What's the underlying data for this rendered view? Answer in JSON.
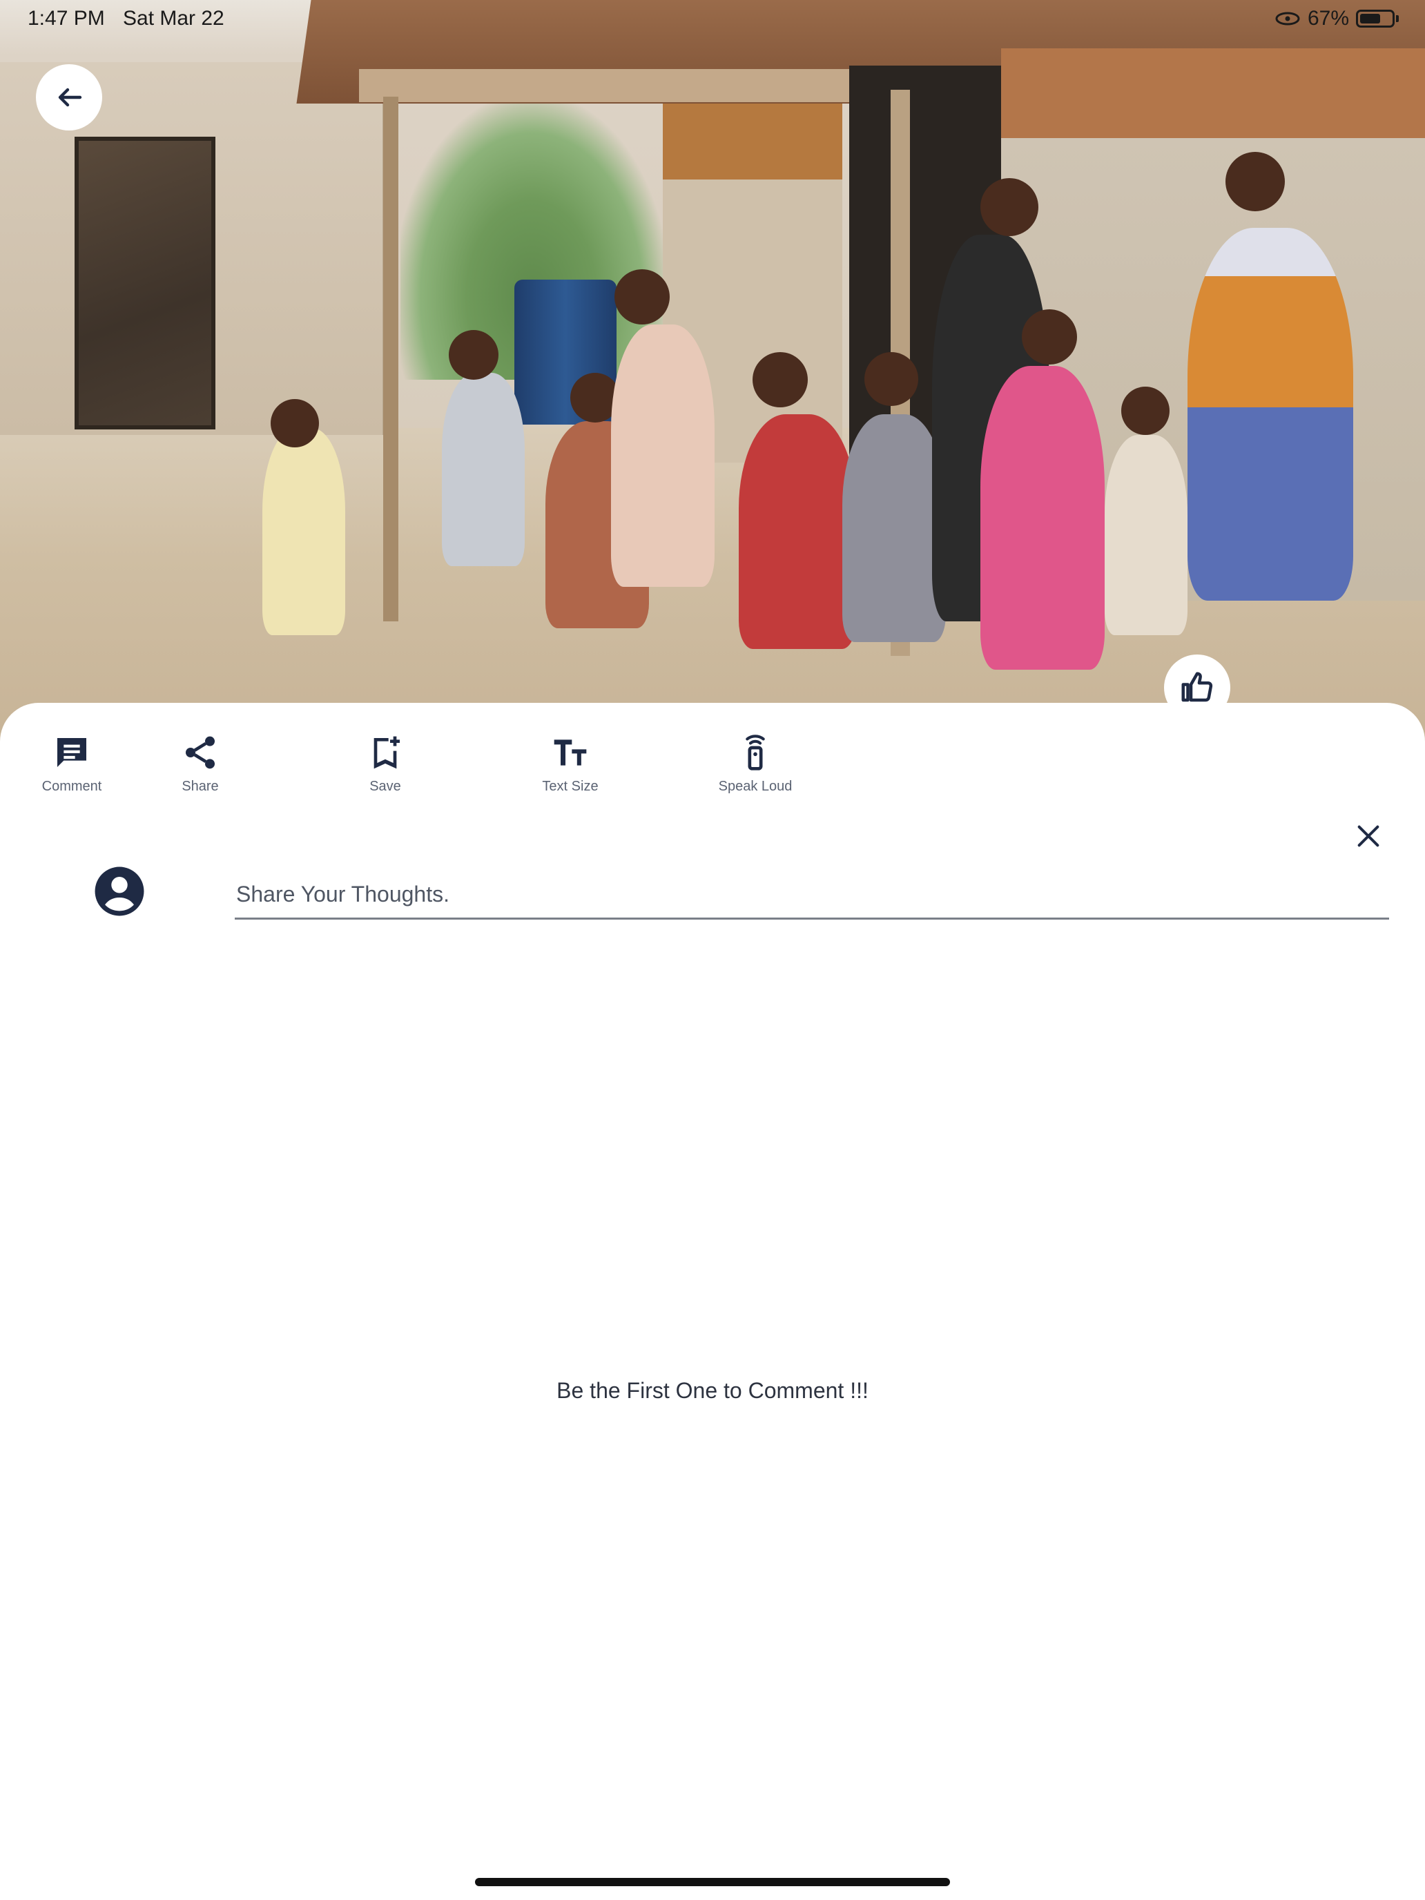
{
  "status_bar": {
    "time": "1:47 PM",
    "date": "Sat Mar 22",
    "battery": "67%",
    "battery_level": 0.67
  },
  "hero": {
    "image_alt": "",
    "back_icon": "arrow-left-icon",
    "like_icon": "thumbs-up-icon"
  },
  "toolbar": {
    "items": [
      {
        "label": "Comment",
        "icon": "comment-icon"
      },
      {
        "label": "Share",
        "icon": "share-icon"
      },
      {
        "label": "Save",
        "icon": "bookmark-add-icon"
      },
      {
        "label": "Text Size",
        "icon": "text-size-icon"
      },
      {
        "label": "Speak Loud",
        "icon": "speaker-icon"
      }
    ]
  },
  "comments": {
    "placeholder": "Share Your Thoughts.",
    "value": "",
    "empty_message": "Be the First One to Comment !!!",
    "close_icon": "close-icon",
    "avatar_icon": "account-circle-icon"
  },
  "colors": {
    "icon": "#1f2a44",
    "label": "#5b6373",
    "underline": "#7a7f88"
  }
}
